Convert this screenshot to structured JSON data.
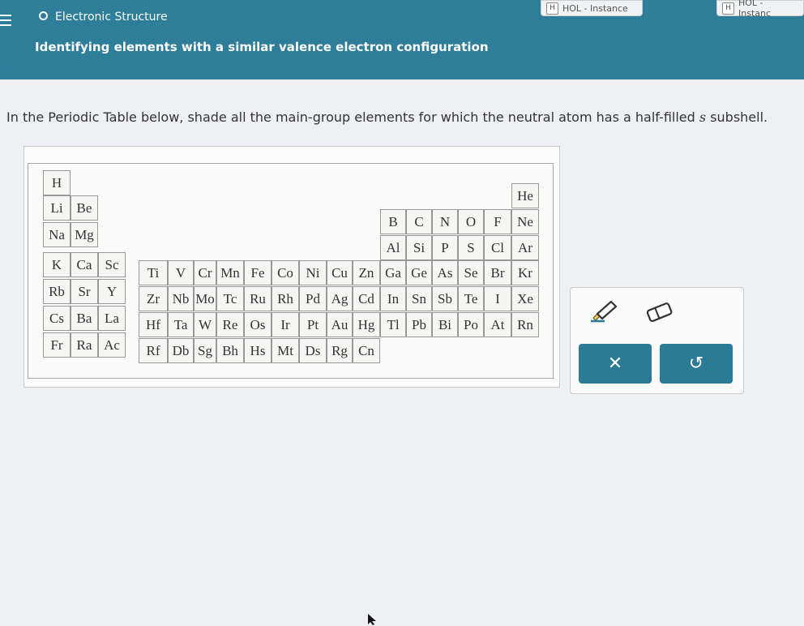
{
  "header": {
    "section": "Electronic Structure",
    "subtitle": "Identifying elements with a similar valence electron configuration",
    "hol_tab_1": "HOL - Instance",
    "hol_tab_2": "HOL - Instanc",
    "hol_badge": "H"
  },
  "question": {
    "before": "In the Periodic Table below, shade all the main-group elements for which the neutral atom has a half-filled ",
    "italic": "s",
    "after": " subshell."
  },
  "periodic_table": {
    "H": "H",
    "He": "He",
    "Li": "Li",
    "Be": "Be",
    "B": "B",
    "C": "C",
    "N": "N",
    "O": "O",
    "F": "F",
    "Ne": "Ne",
    "Na": "Na",
    "Mg": "Mg",
    "Al": "Al",
    "Si": "Si",
    "P": "P",
    "S": "S",
    "Cl": "Cl",
    "Ar": "Ar",
    "K": "K",
    "Ca": "Ca",
    "Sc": "Sc",
    "Ti": "Ti",
    "V": "V",
    "Cr": "Cr",
    "Mn": "Mn",
    "Fe": "Fe",
    "Co": "Co",
    "Ni": "Ni",
    "Cu": "Cu",
    "Zn": "Zn",
    "Ga": "Ga",
    "Ge": "Ge",
    "As": "As",
    "Se": "Se",
    "Br": "Br",
    "Kr": "Kr",
    "Rb": "Rb",
    "Sr": "Sr",
    "Y": "Y",
    "Zr": "Zr",
    "Nb": "Nb",
    "Mo": "Mo",
    "Tc": "Tc",
    "Ru": "Ru",
    "Rh": "Rh",
    "Pd": "Pd",
    "Ag": "Ag",
    "Cd": "Cd",
    "In": "In",
    "Sn": "Sn",
    "Sb": "Sb",
    "Te": "Te",
    "I": "I",
    "Xe": "Xe",
    "Cs": "Cs",
    "Ba": "Ba",
    "La": "La",
    "Hf": "Hf",
    "Ta": "Ta",
    "W": "W",
    "Re": "Re",
    "Os": "Os",
    "Ir": "Ir",
    "Pt": "Pt",
    "Au": "Au",
    "Hg": "Hg",
    "Tl": "Tl",
    "Pb": "Pb",
    "Bi": "Bi",
    "Po": "Po",
    "At": "At",
    "Rn": "Rn",
    "Fr": "Fr",
    "Ra": "Ra",
    "Ac": "Ac",
    "Rf": "Rf",
    "Db": "Db",
    "Sg": "Sg",
    "Bh": "Bh",
    "Hs": "Hs",
    "Mt": "Mt",
    "Ds": "Ds",
    "Rg": "Rg",
    "Cn": "Cn"
  },
  "tools": {
    "highlighter_icon": "highlighter-icon",
    "eraser_icon": "eraser-icon",
    "clear_label": "✕",
    "undo_label": "↺"
  },
  "colors": {
    "header_bg": "#2e7d99",
    "button_bg": "#2b7a96",
    "cell_bg": "#f6f6f4"
  }
}
